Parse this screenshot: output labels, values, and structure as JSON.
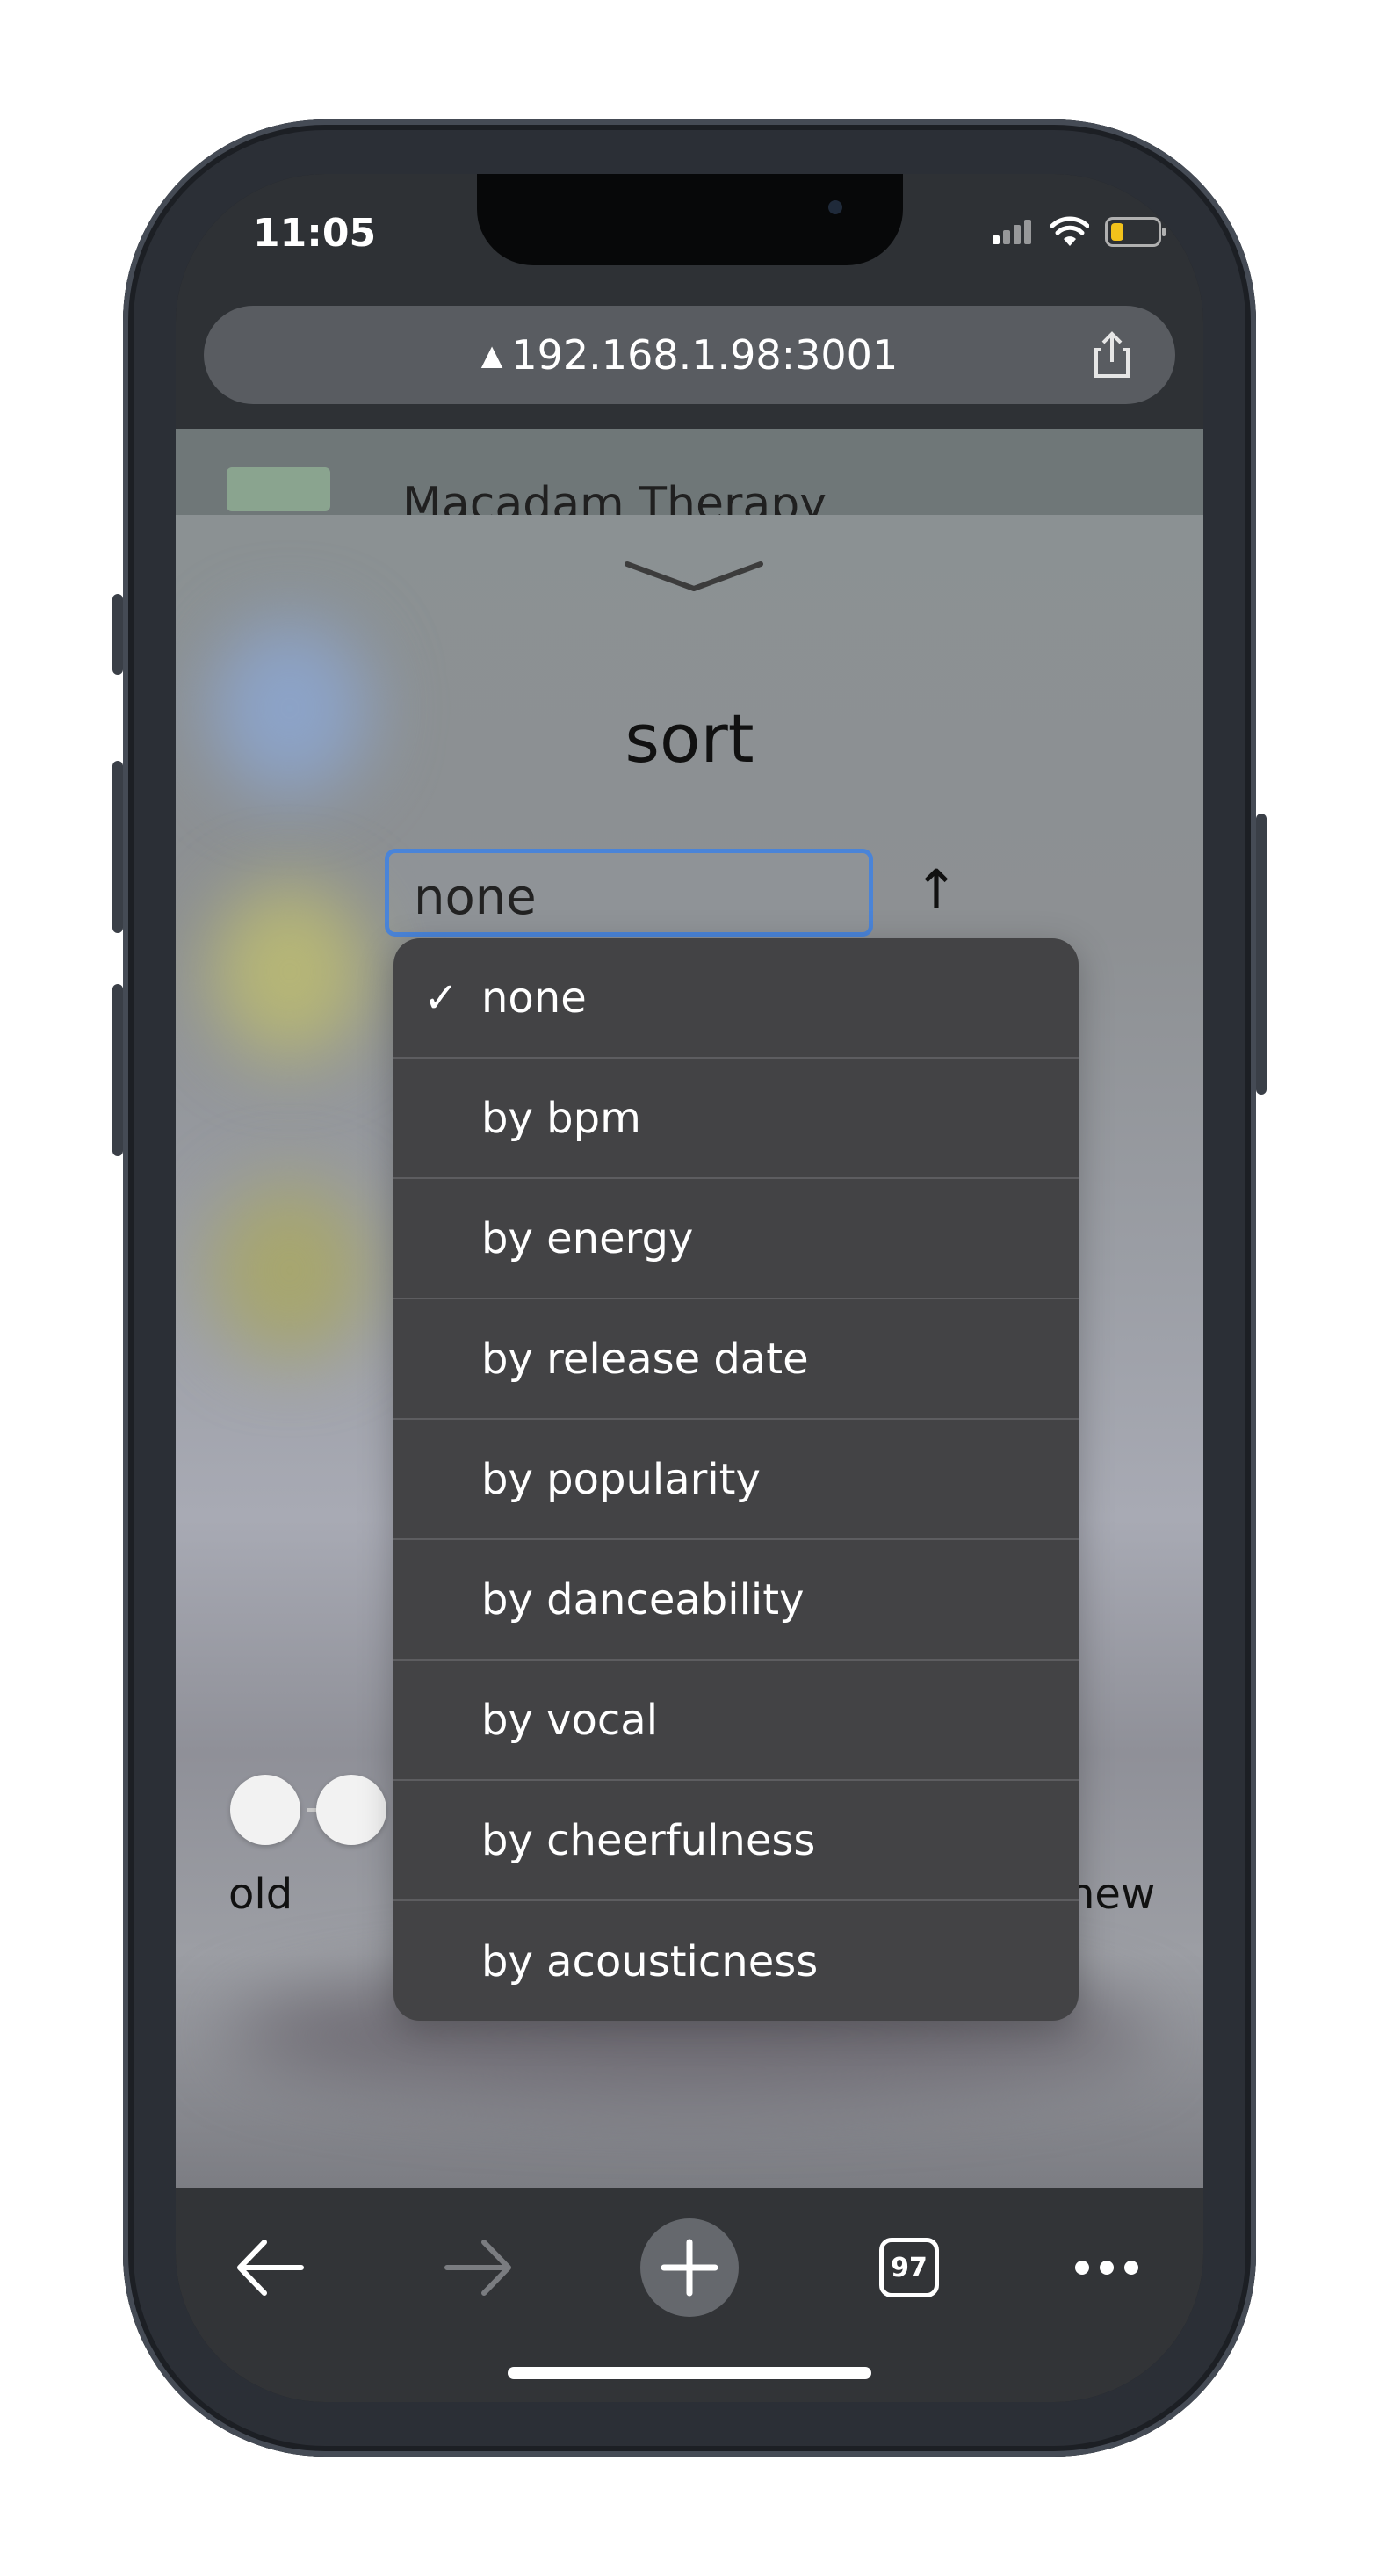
{
  "status_bar": {
    "time": "11:05"
  },
  "browser": {
    "url": "192.168.1.98:3001",
    "warning_icon": "warning-triangle-icon"
  },
  "page_behind": {
    "title_partial": "Macadam Therapy"
  },
  "sheet": {
    "title": "sort",
    "select": {
      "value": "none"
    },
    "direction_arrow": "↑",
    "slider": {
      "left_label": "old",
      "right_label": "new"
    }
  },
  "dropdown": {
    "options": [
      {
        "label": "none",
        "selected": true
      },
      {
        "label": "by bpm"
      },
      {
        "label": "by energy"
      },
      {
        "label": "by release date"
      },
      {
        "label": "by popularity"
      },
      {
        "label": "by danceability"
      },
      {
        "label": "by vocal"
      },
      {
        "label": "by cheerfulness"
      },
      {
        "label": "by acousticness"
      }
    ],
    "check_mark": "✓"
  },
  "toolbar": {
    "tab_count": "97"
  },
  "colors": {
    "focus_ring": "#4a84d8",
    "menu_bg": "#434345",
    "battery_level": "#f2c21b"
  }
}
